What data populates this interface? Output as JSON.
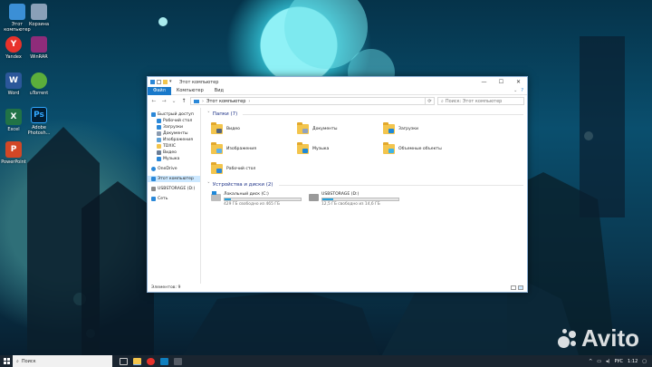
{
  "desktop": {
    "icons": [
      {
        "label": "Этот компьютер",
        "glyph": "",
        "color": "#3b8fd6"
      },
      {
        "label": "Корзина",
        "glyph": "",
        "color": "#8aa0b8"
      },
      {
        "label": "Yandex",
        "glyph": "Y",
        "color": "#e8322b"
      },
      {
        "label": "WinRAR",
        "glyph": "",
        "color": "#8e2c7a"
      },
      {
        "label": "Word",
        "glyph": "W",
        "color": "#2b579a"
      },
      {
        "label": "uTorrent",
        "glyph": "",
        "color": "#5cae3b"
      },
      {
        "label": "Excel",
        "glyph": "X",
        "color": "#217346"
      },
      {
        "label": "Adobe Photosh...",
        "glyph": "Ps",
        "color": "#001d34"
      },
      {
        "label": "PowerPoint",
        "glyph": "P",
        "color": "#d24726"
      }
    ]
  },
  "window": {
    "title": "Этот компьютер",
    "title_icon": "pc-icon",
    "controls": {
      "minimize": "—",
      "maximize": "☐",
      "close": "✕"
    },
    "ribbon_tabs": [
      {
        "label": "Файл",
        "active": true
      },
      {
        "label": "Компьютер",
        "active": false
      },
      {
        "label": "Вид",
        "active": false
      }
    ],
    "address": {
      "path": "Этот компьютер",
      "separator": "›",
      "search_placeholder": "Поиск: Этот компьютер"
    },
    "nav": {
      "items": [
        {
          "label": "Быстрый доступ",
          "icon": "star-icon",
          "color": "#2b88d8"
        },
        {
          "label": "Рабочий стол",
          "icon": "desktop-icon",
          "color": "#2b88d8"
        },
        {
          "label": "Загрузки",
          "icon": "download-icon",
          "color": "#2b88d8"
        },
        {
          "label": "Документы",
          "icon": "documents-icon",
          "color": "#8b9bb0"
        },
        {
          "label": "Изображения",
          "icon": "pictures-icon",
          "color": "#5fa3d9"
        },
        {
          "label": "TDXIC",
          "icon": "folder-icon",
          "color": "#f3c54d"
        },
        {
          "label": "Видео",
          "icon": "video-icon",
          "color": "#6b7d96"
        },
        {
          "label": "Музыка",
          "icon": "music-icon",
          "color": "#2b88d8"
        },
        {
          "label": "OneDrive",
          "icon": "cloud-icon",
          "color": "#2b88d8"
        },
        {
          "label": "Этот компьютер",
          "icon": "pc-icon",
          "color": "#2b88d8"
        },
        {
          "label": "USBSTORAGE (D:)",
          "icon": "usb-drive-icon",
          "color": "#8a8a8a"
        },
        {
          "label": "Сеть",
          "icon": "network-icon",
          "color": "#2b88d8"
        }
      ]
    },
    "folders_section": {
      "title": "Папки (7)",
      "items": [
        {
          "label": "Видео",
          "badge_color": "#53657e"
        },
        {
          "label": "Документы",
          "badge_color": "#8fa2c0"
        },
        {
          "label": "Загрузки",
          "badge_color": "#1e88d8"
        },
        {
          "label": "Изображения",
          "badge_color": "#5fb1ea"
        },
        {
          "label": "Музыка",
          "badge_color": "#1e88d8"
        },
        {
          "label": "Объемные объекты",
          "badge_color": "#3fb3e6"
        },
        {
          "label": "Рабочий стол",
          "badge_color": "#2b88d8"
        }
      ]
    },
    "drives_section": {
      "title": "Устройства и диски (2)",
      "items": [
        {
          "label": "Локальный диск (C:)",
          "free": "429 ГБ свободно из 465 ГБ",
          "used_fraction": 0.08,
          "has_windows": true
        },
        {
          "label": "USBSTORAGE (D:)",
          "free": "12,5 ГБ свободно из 14,6 ГБ",
          "used_fraction": 0.14,
          "has_windows": false
        }
      ]
    },
    "status": "Элементов: 9"
  },
  "taskbar": {
    "search_placeholder": "Поиск",
    "apps": [
      "#3a7bd5",
      "#f3c54d",
      "#e8322b",
      "#0f7fbf",
      "#555c66"
    ],
    "clock": "1:12",
    "lang": "РУС"
  },
  "watermark": "Avito"
}
